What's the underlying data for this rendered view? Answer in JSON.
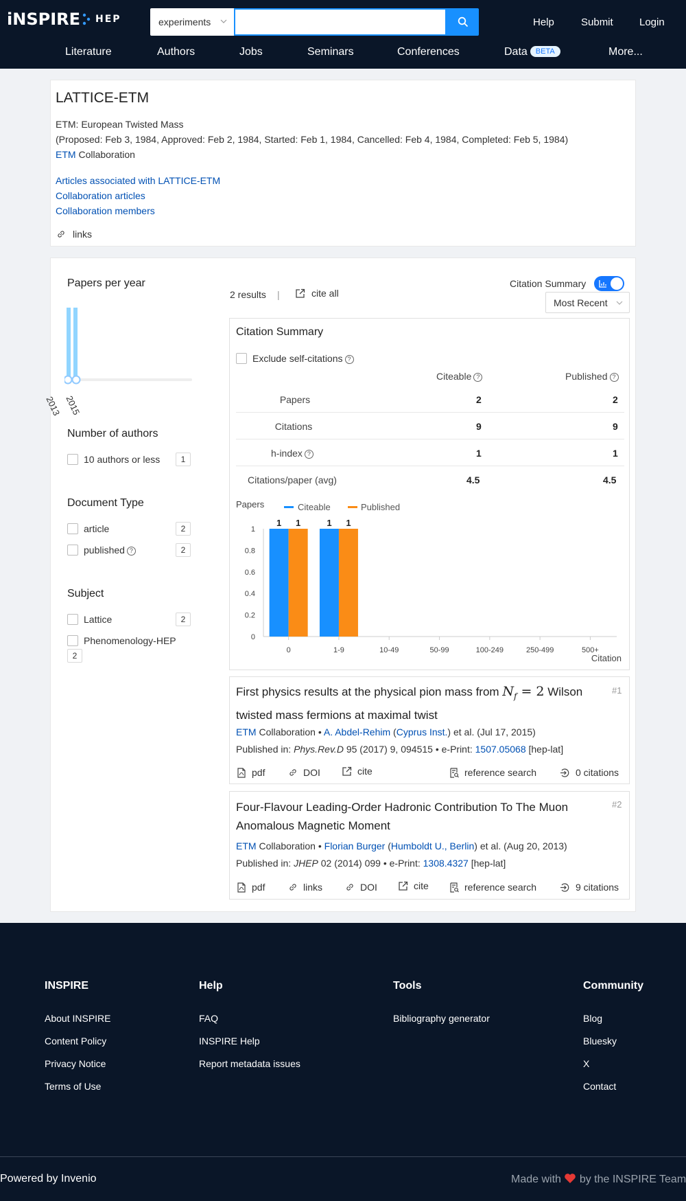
{
  "header": {
    "logo_main": "iNSPIRE",
    "logo_sub": "HEP",
    "search_scope": "experiments",
    "search_placeholder": "",
    "nav_right": [
      "Help",
      "Submit",
      "Login"
    ],
    "menu": [
      "Literature",
      "Authors",
      "Jobs",
      "Seminars",
      "Conferences",
      "Data",
      "More..."
    ],
    "beta_badge": "BETA"
  },
  "experiment": {
    "title": "LATTICE-ETM",
    "long_name": "ETM: European Twisted Mass",
    "dates": "(Proposed: Feb 3, 1984, Approved: Feb 2, 1984, Started: Feb 1, 1984, Cancelled: Feb 4, 1984, Completed: Feb 5, 1984)",
    "collaboration_link": "ETM",
    "collaboration_suffix": "Collaboration",
    "links": [
      "Articles associated with LATTICE-ETM",
      "Collaboration articles",
      "Collaboration members"
    ],
    "links_label": "links"
  },
  "facets": {
    "papers_per_year_title": "Papers per year",
    "year_labels": [
      "2013",
      "2015"
    ],
    "year_counts": [
      1,
      1
    ],
    "authors_title": "Number of authors",
    "authors_option": "10 authors or less",
    "authors_count": "1",
    "doctype_title": "Document Type",
    "doctype_options": [
      {
        "label": "article",
        "count": "2"
      },
      {
        "label": "published",
        "count": "2"
      }
    ],
    "subject_title": "Subject",
    "subject_options": [
      {
        "label": "Lattice",
        "count": "2"
      },
      {
        "label": "Phenomenology-HEP",
        "count": "2"
      }
    ]
  },
  "results_bar": {
    "count": "2 results",
    "separator": "|",
    "cite_all": "cite all",
    "citation_summary_label": "Citation Summary",
    "toggle_on": true,
    "sort": "Most Recent"
  },
  "citation_summary": {
    "title": "Citation Summary",
    "exclude_self": "Exclude self-citations",
    "col_citeable": "Citeable",
    "col_published": "Published",
    "rows": [
      {
        "label": "Papers",
        "citeable": "2",
        "published": "2"
      },
      {
        "label": "Citations",
        "citeable": "9",
        "published": "9"
      },
      {
        "label": "h-index",
        "citeable": "1",
        "published": "1"
      },
      {
        "label": "Citations/paper (avg)",
        "citeable": "4.5",
        "published": "4.5"
      }
    ]
  },
  "chart_data": {
    "type": "bar",
    "ylabel": "Papers",
    "xlabel": "Citation",
    "categories": [
      "0",
      "1-9",
      "10-49",
      "50-99",
      "100-249",
      "250-499",
      "500+"
    ],
    "series": [
      {
        "name": "Citeable",
        "values": [
          1,
          1,
          0,
          0,
          0,
          0,
          0
        ],
        "color": "#1890ff"
      },
      {
        "name": "Published",
        "values": [
          1,
          1,
          0,
          0,
          0,
          0,
          0
        ],
        "color": "#fa8c16"
      }
    ],
    "yticks": [
      "0",
      "0.2",
      "0.4",
      "0.6",
      "0.8",
      "1"
    ],
    "ylim": [
      0,
      1
    ],
    "legend": "top-left",
    "grid": false
  },
  "results": [
    {
      "rank": "#1",
      "title_a": "First physics results at the physical pion mass from",
      "title_math_n": "N",
      "title_math_sub": "f",
      "title_math_eq": "= 2",
      "title_b": "Wilson twisted mass fermions at maximal twist",
      "collab_link": "ETM",
      "collab_suffix": "Collaboration",
      "bullet": "•",
      "author": "A. Abdel-Rehim",
      "affiliation": "Cyprus Inst.",
      "etal_date": "et al. (Jul 17, 2015)",
      "pub_prefix": "Published in:",
      "journal": "Phys.Rev.D",
      "pub_details": "95 (2017) 9, 094515",
      "eprint_label": "e-Print:",
      "eprint": "1507.05068",
      "arxiv_cat": "[hep-lat]",
      "actions": [
        "pdf",
        "DOI",
        "cite"
      ],
      "ref_search": "reference search",
      "citations": "0 citations"
    },
    {
      "rank": "#2",
      "title": "Four-Flavour Leading-Order Hadronic Contribution To The Muon Anomalous Magnetic Moment",
      "collab_link": "ETM",
      "collab_suffix": "Collaboration",
      "bullet": "•",
      "author": "Florian Burger",
      "affiliation": "Humboldt U., Berlin",
      "etal_date": "et al. (Aug 20, 2013)",
      "pub_prefix": "Published in:",
      "journal": "JHEP",
      "pub_details": "02 (2014) 099",
      "eprint_label": "e-Print:",
      "eprint": "1308.4327",
      "arxiv_cat": "[hep-lat]",
      "actions": [
        "pdf",
        "links",
        "DOI",
        "cite"
      ],
      "ref_search": "reference search",
      "citations": "9 citations"
    }
  ],
  "footer": {
    "columns": [
      {
        "title": "INSPIRE",
        "items": [
          "About INSPIRE",
          "Content Policy",
          "Privacy Notice",
          "Terms of Use"
        ]
      },
      {
        "title": "Help",
        "items": [
          "FAQ",
          "INSPIRE Help",
          "Report metadata issues"
        ]
      },
      {
        "title": "Tools",
        "items": [
          "Bibliography generator"
        ]
      },
      {
        "title": "Community",
        "items": [
          "Blog",
          "Bluesky",
          "X",
          "Contact"
        ]
      }
    ],
    "powered_by": "Powered by Invenio",
    "made_with_a": "Made with",
    "made_with_b": "by the INSPIRE Team"
  }
}
